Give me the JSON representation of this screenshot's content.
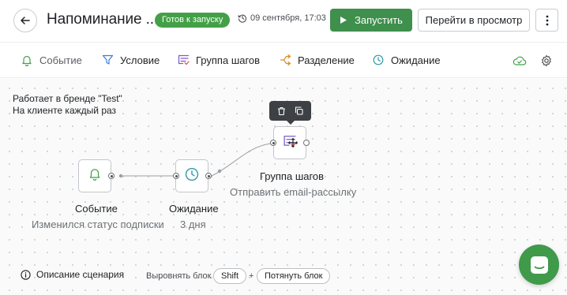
{
  "header": {
    "title": "Напоминание ...",
    "status_badge": "Готов к запуску",
    "date": "09 сентября, 17:03",
    "run_label": "Запустить",
    "preview_label": "Перейти в просмотр"
  },
  "toolbar": {
    "items": [
      {
        "label": "Событие",
        "icon": "bell-icon"
      },
      {
        "label": "Условие",
        "icon": "filter-icon"
      },
      {
        "label": "Группа шагов",
        "icon": "step-group-icon"
      },
      {
        "label": "Разделение",
        "icon": "split-icon"
      },
      {
        "label": "Ожидание",
        "icon": "clock-icon"
      }
    ],
    "cloud_icon": "cloud-check-icon",
    "settings_icon": "gear-icon"
  },
  "canvas": {
    "brand_line": "Работает в бренде \"Test\"",
    "client_line": "На клиенте каждый раз",
    "nodes": [
      {
        "title": "Событие",
        "subtitle": "Изменился статус подписки",
        "icon": "bell-icon"
      },
      {
        "title": "Ожидание",
        "subtitle": "3 дня",
        "icon": "clock-icon"
      },
      {
        "title": "Группа шагов",
        "subtitle": "Отправить email-рассылку",
        "icon": "step-group-icon"
      }
    ],
    "popover": {
      "delete_icon": "trash-icon",
      "copy_icon": "copy-icon"
    }
  },
  "footer": {
    "description_label": "Описание сценария",
    "align_hint": "Выровнять блок",
    "key_shift": "Shift",
    "plus": "+",
    "key_drag": "Потянуть блок"
  },
  "colors": {
    "accent_green": "#3f8f4d",
    "badge_green": "#43a047",
    "clock_teal": "#2f9aa8",
    "split_orange": "#d98c2b",
    "group_purple": "#7a5cc7"
  }
}
